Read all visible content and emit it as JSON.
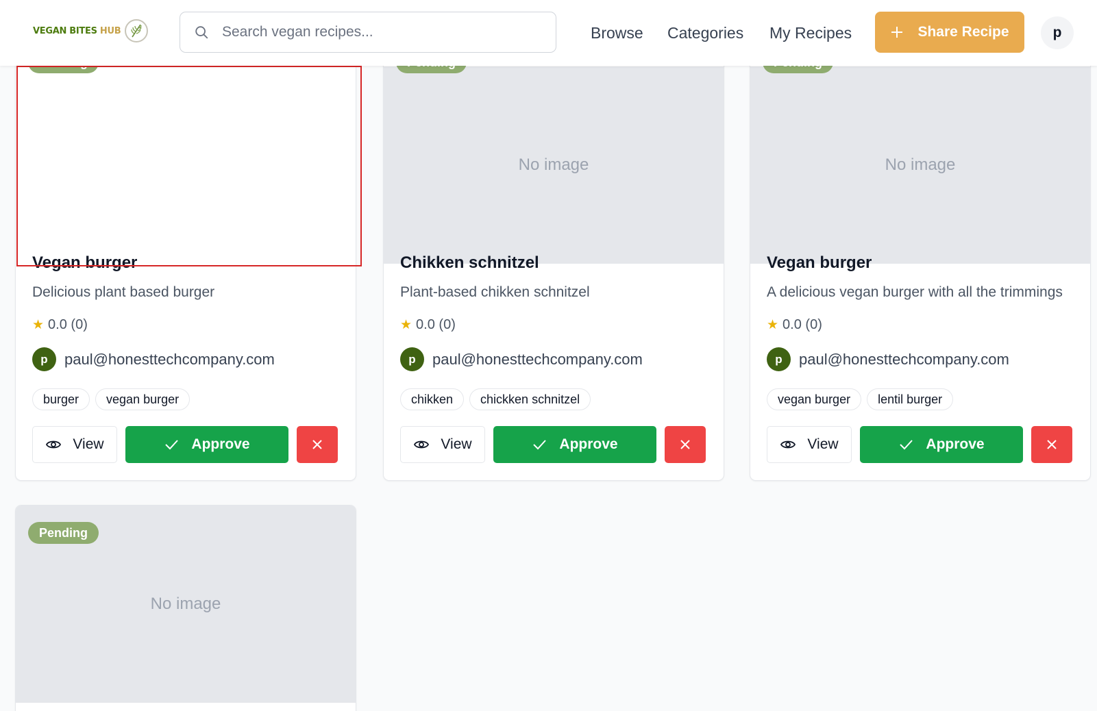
{
  "brand": {
    "part1": "VEGAN BITES",
    "part2": "HUB"
  },
  "search": {
    "placeholder": "Search vegan recipes..."
  },
  "nav": {
    "browse": "Browse",
    "categories": "Categories",
    "my_recipes": "My Recipes"
  },
  "share_button": {
    "label": "Share Recipe"
  },
  "user": {
    "initial": "p"
  },
  "colors": {
    "brand_green": "#4d7c0f",
    "accent_orange": "#e9ab4f",
    "approve_green": "#16a34a",
    "reject_red": "#ef4444",
    "pending_badge": "#8fac6f",
    "selection_outline": "#d62626"
  },
  "cards": [
    {
      "badge": "Pending",
      "image_text": "",
      "title": "Vegan burger",
      "description": "Delicious plant based burger",
      "rating": "0.0 (0)",
      "author_initial": "p",
      "author": "paul@honesttechcompany.com",
      "tags": [
        "burger",
        "vegan burger"
      ],
      "view_label": "View",
      "approve_label": "Approve"
    },
    {
      "badge": "Pending",
      "image_text": "No image",
      "title": "Chikken schnitzel",
      "description": "Plant-based chikken schnitzel",
      "rating": "0.0 (0)",
      "author_initial": "p",
      "author": "paul@honesttechcompany.com",
      "tags": [
        "chikken",
        "chickken schnitzel"
      ],
      "view_label": "View",
      "approve_label": "Approve"
    },
    {
      "badge": "Pending",
      "image_text": "No image",
      "title": "Vegan burger",
      "description": "A delicious vegan burger with all the trimmings",
      "rating": "0.0 (0)",
      "author_initial": "p",
      "author": "paul@honesttechcompany.com",
      "tags": [
        "vegan burger",
        "lentil burger"
      ],
      "view_label": "View",
      "approve_label": "Approve"
    },
    {
      "badge": "Pending",
      "image_text": "No image"
    }
  ]
}
